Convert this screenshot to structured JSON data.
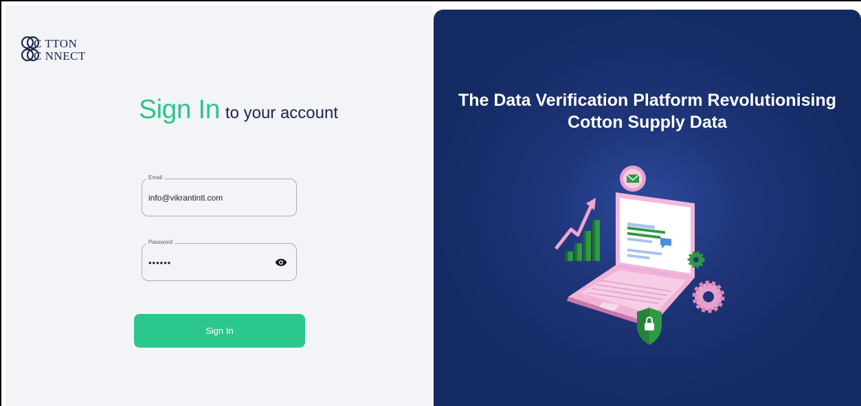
{
  "brand": {
    "logo_line1": "C TTON",
    "logo_line2": "C NNECT"
  },
  "signin_form": {
    "heading_accent": "Sign In",
    "heading_rest": "to your account",
    "email": {
      "label": "Email",
      "value": "info@vikrantintl.com"
    },
    "password": {
      "label": "Password",
      "value": "••••••"
    },
    "submit_label": "Sign In"
  },
  "hero": {
    "tagline_line1": "The Data Verification Platform Revolutionising",
    "tagline_line2": "Cotton Supply Data"
  },
  "icons": {
    "password_toggle": "eye-icon"
  },
  "colors": {
    "accent_green": "#2ec58a",
    "button_green": "#2bc78c",
    "navy_text": "#1a2450",
    "hero_bg": "#142a63",
    "left_bg": "#f3f4f8"
  }
}
